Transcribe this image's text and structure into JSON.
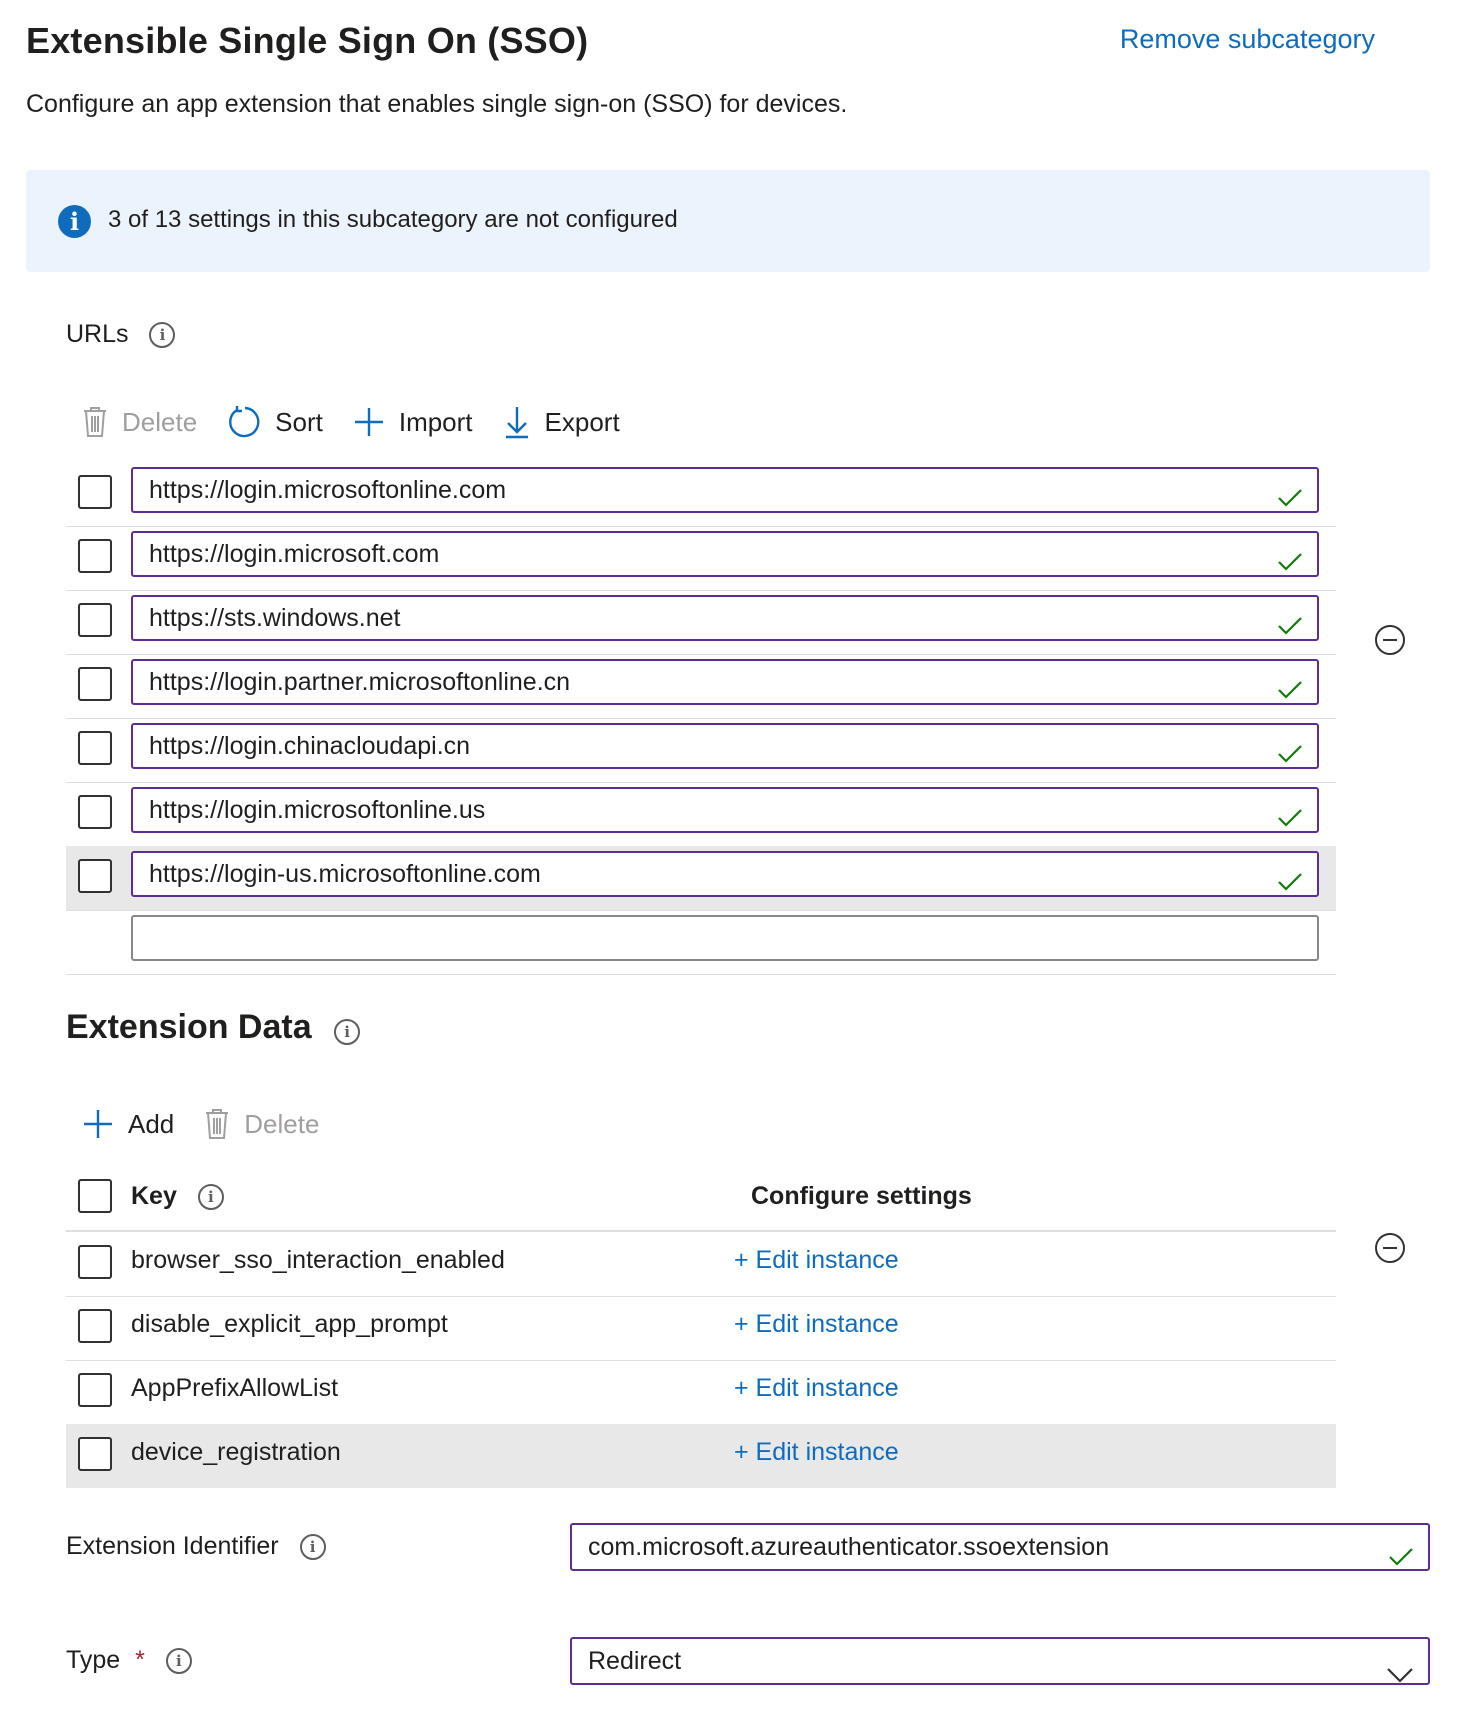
{
  "header": {
    "title": "Extensible Single Sign On (SSO)",
    "remove_label": "Remove subcategory",
    "description": "Configure an app extension that enables single sign-on (SSO) for devices."
  },
  "banner": {
    "text": "3 of 13 settings in this subcategory are not configured",
    "icon": "info-icon"
  },
  "urls": {
    "label": "URLs",
    "toolbar": {
      "delete_label": "Delete",
      "sort_label": "Sort",
      "import_label": "Import",
      "export_label": "Export"
    },
    "items": [
      "https://login.microsoftonline.com",
      "https://login.microsoft.com",
      "https://sts.windows.net",
      "https://login.partner.microsoftonline.cn",
      "https://login.chinacloudapi.cn",
      "https://login.microsoftonline.us",
      "https://login-us.microsoftonline.com"
    ],
    "new_value": ""
  },
  "extension_data": {
    "title": "Extension Data",
    "toolbar": {
      "add_label": "Add",
      "delete_label": "Delete"
    },
    "columns": {
      "key": "Key",
      "configure": "Configure settings"
    },
    "rows": [
      {
        "key": "browser_sso_interaction_enabled",
        "action": "+ Edit instance"
      },
      {
        "key": "disable_explicit_app_prompt",
        "action": "+ Edit instance"
      },
      {
        "key": "AppPrefixAllowList",
        "action": "+ Edit instance"
      },
      {
        "key": "device_registration",
        "action": "+ Edit instance"
      }
    ]
  },
  "extension_identifier": {
    "label": "Extension Identifier",
    "value": "com.microsoft.azureauthenticator.ssoextension"
  },
  "type_field": {
    "label": "Type",
    "required_mark": "*",
    "value": "Redirect"
  },
  "colors": {
    "accent": "#0f6cbd",
    "input_border": "#5c2e91",
    "check": "#107c10",
    "banner_bg": "#ebf3fc",
    "selected_row": "#e8e8e8"
  }
}
